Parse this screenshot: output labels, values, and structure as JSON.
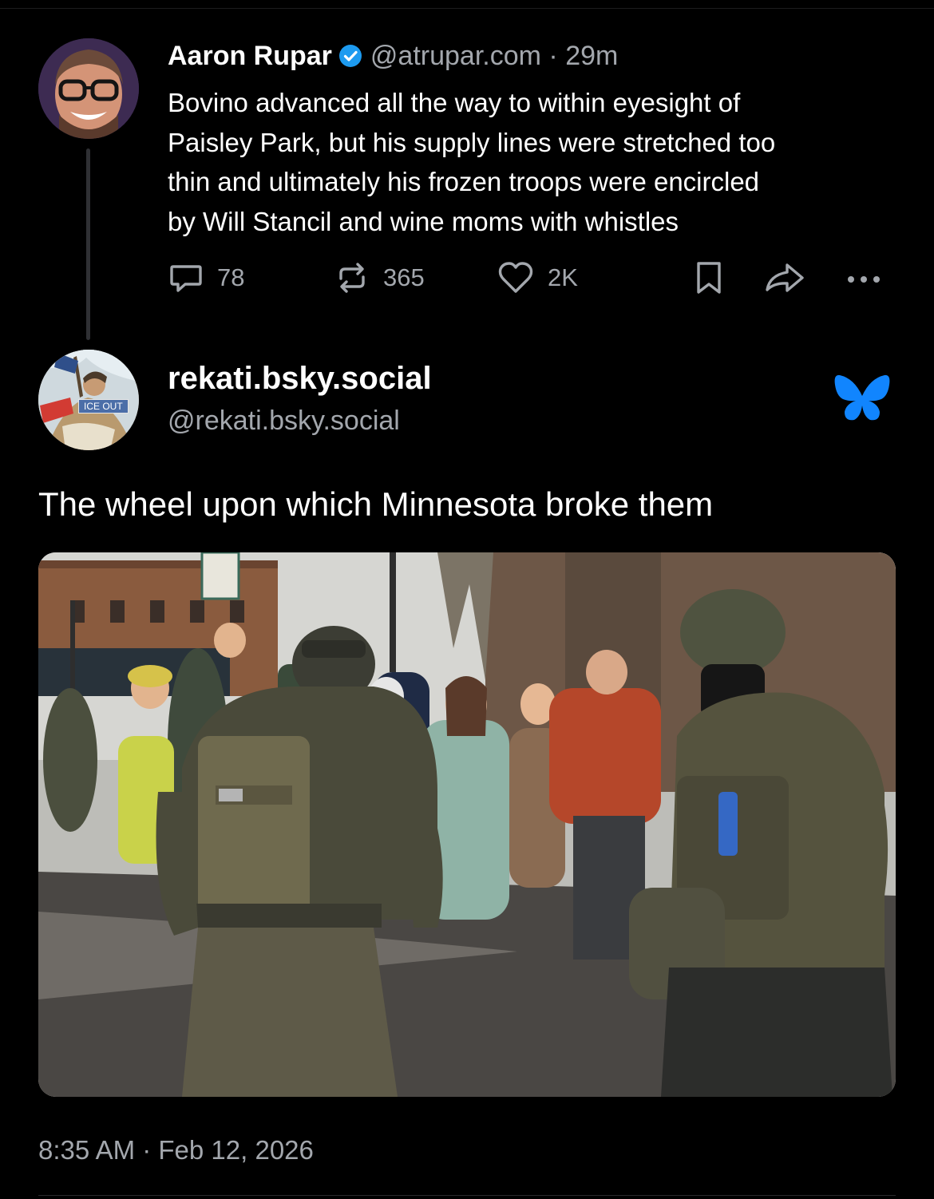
{
  "parent_post": {
    "display_name": "Aaron Rupar",
    "handle": "@atrupar.com",
    "separator": "·",
    "time_ago": "29m",
    "text_lines": [
      "Bovino advanced all the way to within eyesight of",
      "Paisley Park, but his supply lines were stretched too",
      "thin and ultimately his frozen troops were encircled",
      "by Will Stancil and wine moms with whistles"
    ],
    "actions": {
      "replies": "78",
      "reposts": "365",
      "likes": "2K"
    }
  },
  "main_post": {
    "display_name": "rekati.bsky.social",
    "handle": "@rekati.bsky.social",
    "avatar_badge": "ICE OUT",
    "text": "The wheel upon which Minnesota broke them",
    "timestamp": "8:35 AM · Feb 12, 2026"
  },
  "colors": {
    "background": "#000000",
    "text_primary": "#ffffff",
    "text_secondary": "#a3a7ad",
    "verified_blue": "#1d9bf0",
    "bluesky_butterfly": "#1185fe",
    "thread_line": "#2f3034"
  },
  "icons": {
    "reply": "speech-bubble",
    "repost": "repost-arrows",
    "like": "heart-outline",
    "bookmark": "bookmark-outline",
    "share": "share-arrow",
    "more": "ellipsis",
    "verified": "check-circle",
    "bluesky": "butterfly-logo"
  }
}
